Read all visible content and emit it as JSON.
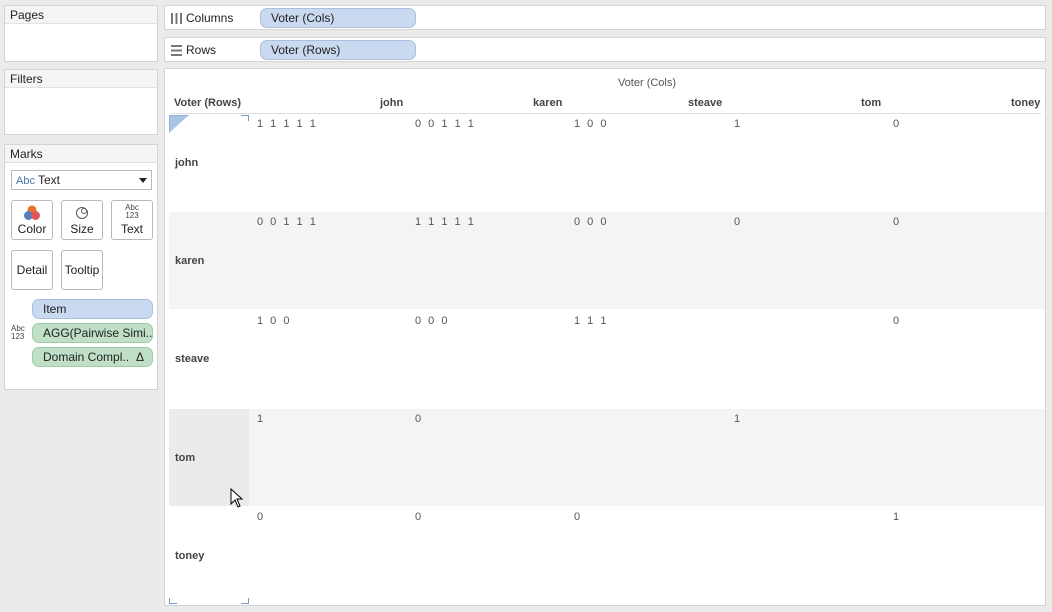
{
  "panels": {
    "pages": "Pages",
    "filters": "Filters",
    "marks": "Marks"
  },
  "marks": {
    "type_abbrev": "Abc",
    "type": "Text",
    "buttons": {
      "color": "Color",
      "size": "Size",
      "text": "Text",
      "detail": "Detail",
      "tooltip": "Tooltip"
    },
    "text_icon_top": "Abc",
    "text_icon_bottom": "123",
    "cards": [
      "Item",
      "AGG(Pairwise Simi..",
      "Domain Compl.."
    ],
    "delta": "Δ"
  },
  "shelves": {
    "columns_label": "Columns",
    "columns_pill": "Voter (Cols)",
    "rows_label": "Rows",
    "rows_pill": "Voter (Rows)"
  },
  "view": {
    "col_title": "Voter (Cols)",
    "row_header": "Voter (Rows)",
    "columns": [
      "john",
      "karen",
      "steave",
      "tom",
      "toney"
    ],
    "rows": [
      {
        "name": "john",
        "cells": [
          "1 1 1 1 1",
          "0 0 1 1 1",
          "1 0 0",
          "1",
          "0"
        ]
      },
      {
        "name": "karen",
        "cells": [
          "0 0 1 1 1",
          "1 1 1 1 1",
          "0 0 0",
          "0",
          "0"
        ]
      },
      {
        "name": "steave",
        "cells": [
          "1 0 0",
          "0 0 0",
          "1 1 1",
          "",
          "0"
        ]
      },
      {
        "name": "tom",
        "cells": [
          "1",
          "0",
          "",
          "1",
          ""
        ]
      },
      {
        "name": "toney",
        "cells": [
          "0",
          "0",
          "0",
          "",
          "1"
        ]
      }
    ]
  },
  "colors": {
    "pill_blue": "#c9d9ef",
    "pill_green": "#bfe0c6",
    "band_shade": "#f4f4f4"
  }
}
